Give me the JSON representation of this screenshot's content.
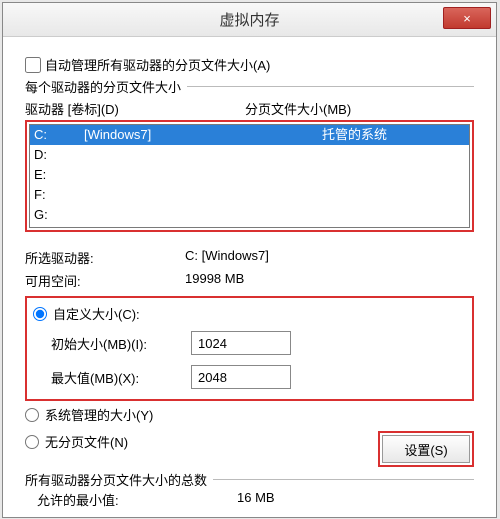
{
  "title": "虚拟内存",
  "close": "×",
  "autoManage": "自动管理所有驱动器的分页文件大小(A)",
  "perDrive": {
    "groupLabel": "每个驱动器的分页文件大小",
    "headerDrive": "驱动器 [卷标](D)",
    "headerPage": "分页文件大小(MB)",
    "rows": [
      {
        "drive": "C:",
        "label": "[Windows7]",
        "page": "托管的系统",
        "selected": true
      },
      {
        "drive": "D:",
        "label": "",
        "page": "",
        "selected": false
      },
      {
        "drive": "E:",
        "label": "",
        "page": "",
        "selected": false
      },
      {
        "drive": "F:",
        "label": "",
        "page": "",
        "selected": false
      },
      {
        "drive": "G:",
        "label": "",
        "page": "",
        "selected": false
      }
    ]
  },
  "selectedDrive": {
    "label": "所选驱动器:",
    "value": "C:  [Windows7]"
  },
  "freeSpace": {
    "label": "可用空间:",
    "value": "19998 MB"
  },
  "customSize": {
    "radioLabel": "自定义大小(C):",
    "initialLabel": "初始大小(MB)(I):",
    "initialValue": "1024",
    "maxLabel": "最大值(MB)(X):",
    "maxValue": "2048"
  },
  "systemManaged": "系统管理的大小(Y)",
  "noPageFile": "无分页文件(N)",
  "setButton": "设置(S)",
  "totals": {
    "groupLabel": "所有驱动器分页文件大小的总数",
    "minAllowedLabel": "允许的最小值:",
    "minAllowedValue": "16 MB"
  }
}
